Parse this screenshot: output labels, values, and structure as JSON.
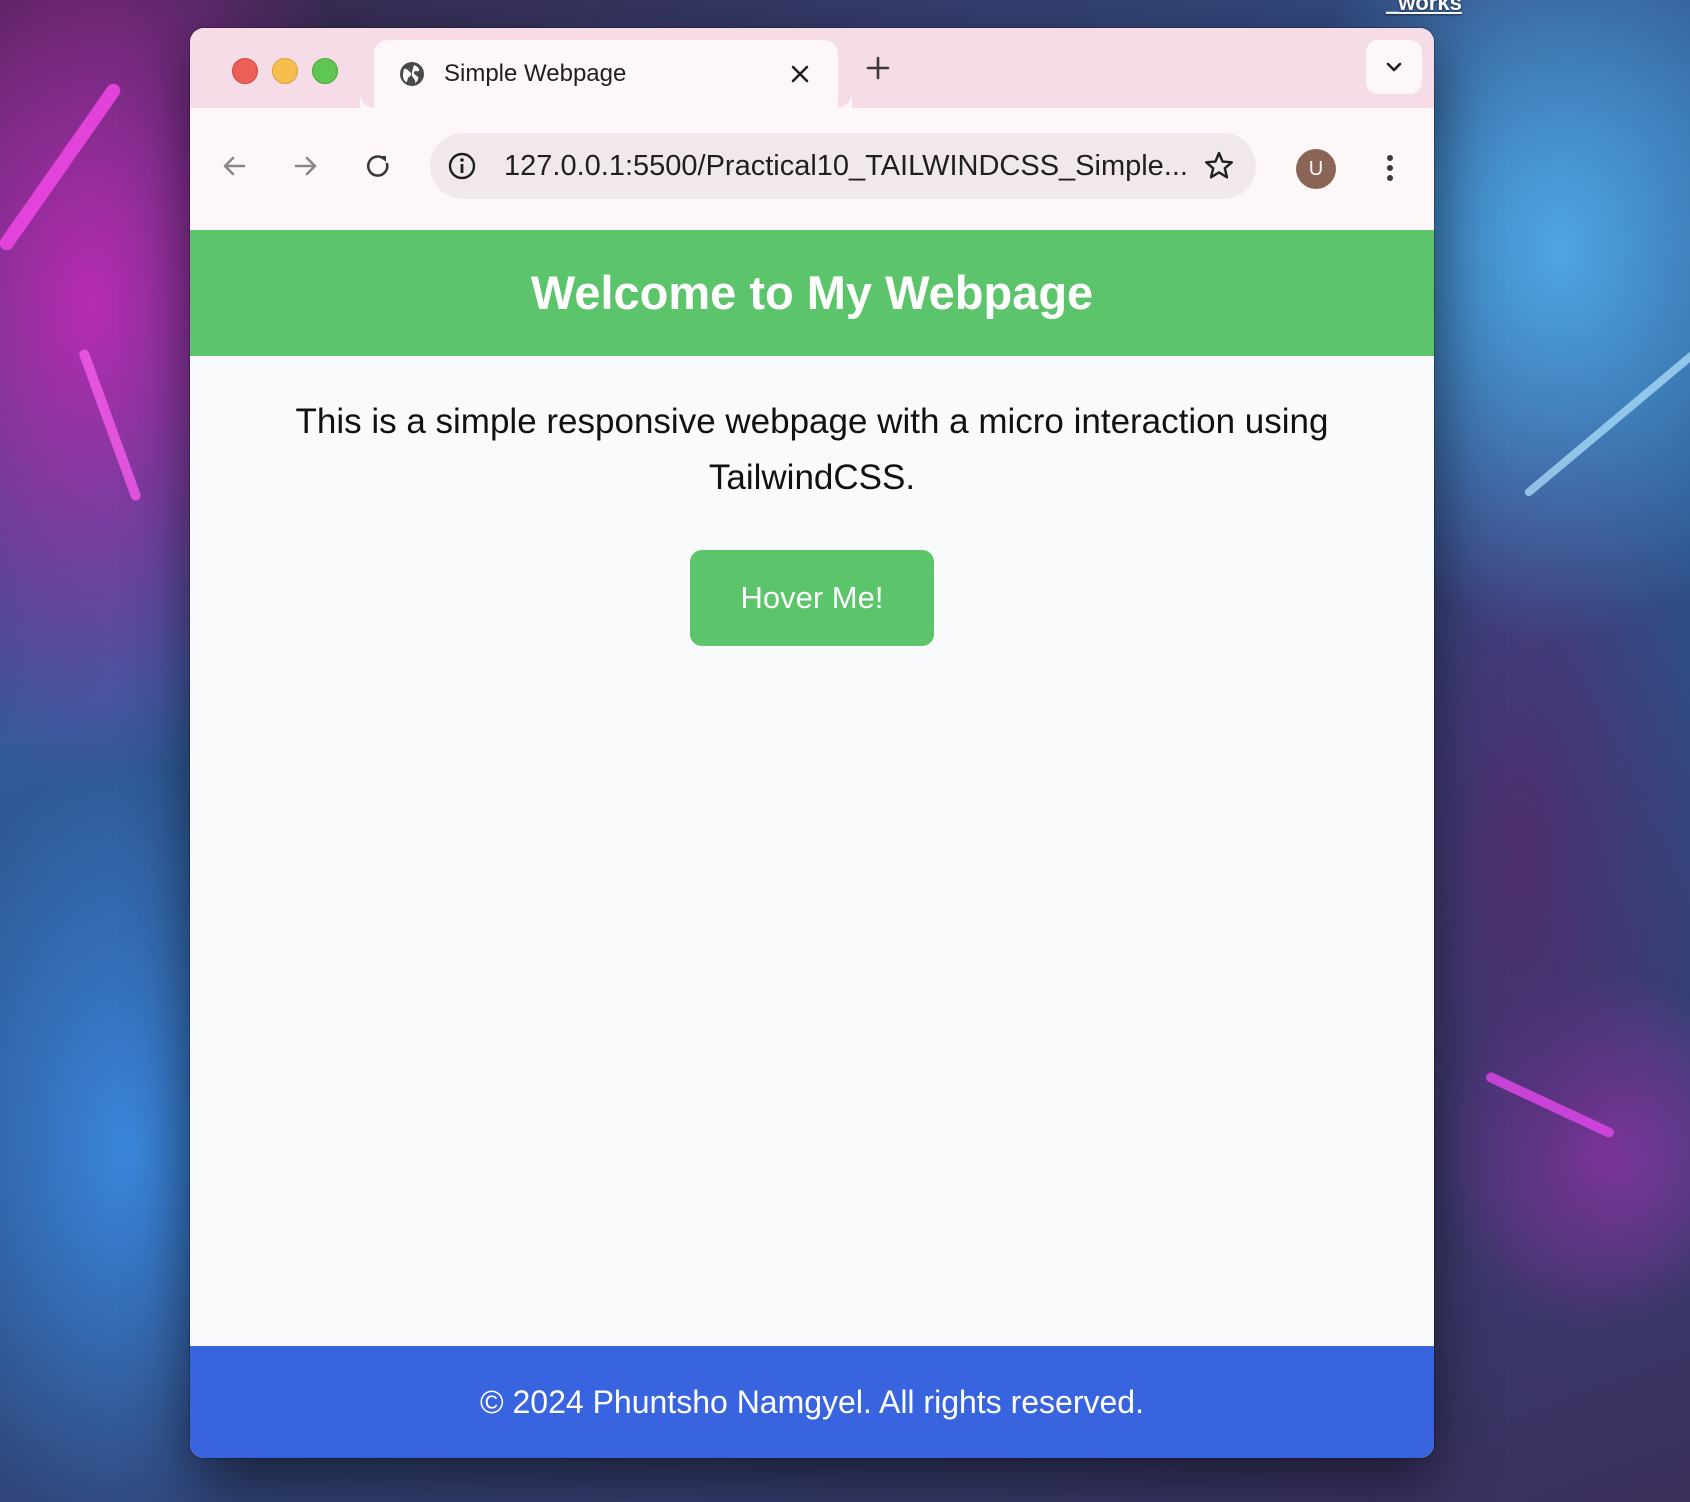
{
  "desktop": {
    "label": "_works"
  },
  "browser": {
    "tab": {
      "title": "Simple Webpage",
      "favicon": "globe-icon"
    },
    "address_bar": {
      "url": "127.0.0.1:5500/Practical10_TAILWINDCSS_Simple..."
    },
    "profile": {
      "initial": "U"
    }
  },
  "page": {
    "header": {
      "title": "Welcome to My Webpage"
    },
    "body": {
      "text": "This is a simple responsive webpage with a micro interaction using TailwindCSS.",
      "button_label": "Hover Me!"
    },
    "footer": {
      "text": "© 2024 Phuntsho Namgyel. All rights reserved."
    }
  },
  "colors": {
    "header_bg": "#5cc46a",
    "button_bg": "#5cc46a",
    "footer_bg": "#3964e0",
    "page_bg": "#f9fafb",
    "tabbar_bg": "#f5dce7"
  }
}
